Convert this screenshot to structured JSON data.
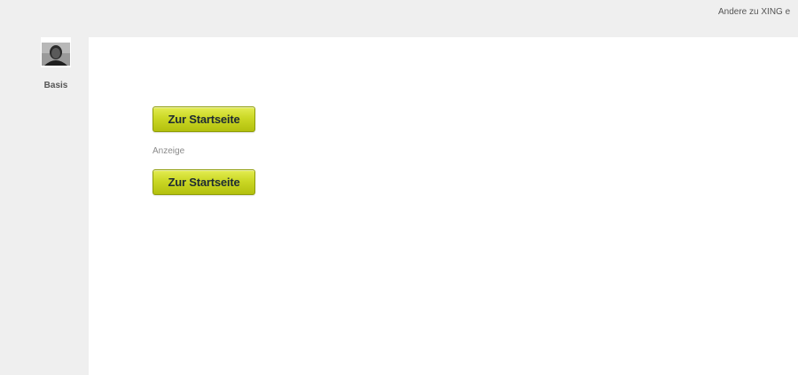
{
  "header": {
    "other_users_link": "Andere zu XING e"
  },
  "profile": {
    "avatar_icon": "user-photo-icon",
    "membership_level": "Basis"
  },
  "main": {
    "primary_button_label": "Zur Startseite",
    "ad_label": "Anzeige",
    "secondary_button_label": "Zur Startseite"
  },
  "colors": {
    "background": "#efefef",
    "panel": "#ffffff",
    "button_green": "#cbd825",
    "button_text": "#1e2a33"
  }
}
